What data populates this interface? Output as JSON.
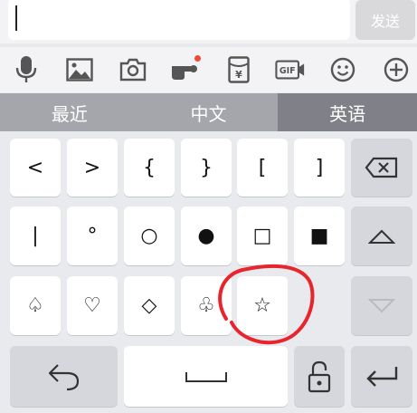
{
  "input": {
    "value": ""
  },
  "send_button": {
    "label": "发送"
  },
  "toolbar": {
    "items": [
      {
        "icon": "microphone-icon"
      },
      {
        "icon": "image-icon"
      },
      {
        "icon": "camera-icon"
      },
      {
        "icon": "finger-pointer-icon",
        "badge": "red-dot"
      },
      {
        "icon": "red-packet-icon"
      },
      {
        "icon": "gif-icon"
      },
      {
        "icon": "emoji-icon"
      },
      {
        "icon": "plus-icon"
      }
    ]
  },
  "tabs": [
    {
      "label": "最近",
      "active": false
    },
    {
      "label": "中文",
      "active": false
    },
    {
      "label": "英语",
      "active": true
    }
  ],
  "keyboard": {
    "row1": [
      "<",
      ">",
      "{",
      "}",
      "[",
      "]"
    ],
    "row2": [
      "|",
      "°",
      "○",
      "●",
      "□",
      "■"
    ],
    "row3": [
      "♤",
      "♡",
      "◇",
      "♧",
      "☆"
    ]
  },
  "colors": {
    "accent_circle": "#e8242c",
    "tab_active": "#808188",
    "tab_bg": "#a5a6ac"
  }
}
